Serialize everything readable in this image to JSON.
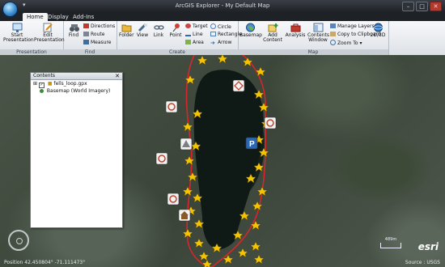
{
  "window": {
    "title": "ArcGIS Explorer - My Default Map"
  },
  "tabs": [
    {
      "label": "Home"
    },
    {
      "label": "Display"
    },
    {
      "label": "Add-Ins"
    }
  ],
  "ribbon": {
    "presentation": {
      "group_label": "Presentation",
      "start": "Start Presentation",
      "edit": "Edit Presentation"
    },
    "find": {
      "group_label": "Find",
      "find": "Find",
      "directions": "Directions",
      "route": "Route",
      "measure": "Measure"
    },
    "create": {
      "group_label": "Create",
      "folder": "Folder",
      "view": "View",
      "link": "Link",
      "point": "Point",
      "target": "Target",
      "line": "Line",
      "area": "Area",
      "circle": "Circle",
      "rectangle": "Rectangle",
      "arrow": "Arrow"
    },
    "map": {
      "group_label": "Map",
      "basemap": "Basemap",
      "add_content": "Add Content",
      "analysis": "Analysis",
      "contents_window": "Contents Window",
      "manage_layers": "Manage Layers",
      "copy_clipboard": "Copy to Clipboard",
      "zoom_to": "Zoom To",
      "toggle_2d3d": "2D/3D"
    }
  },
  "contents": {
    "title": "Contents",
    "layers": [
      {
        "name": "fells_loop.gpx",
        "checked": true
      },
      {
        "name": "Basemap (World Imagery)",
        "checked": true
      }
    ]
  },
  "map": {
    "scale_label": "489m",
    "brand": "esri"
  },
  "status": {
    "position": "Position 42.450804° -71.111473°",
    "source": "Source : USGS"
  },
  "colors": {
    "accent": "#3b8fd3",
    "track": "#d8262b",
    "marker": "#f5c400"
  }
}
